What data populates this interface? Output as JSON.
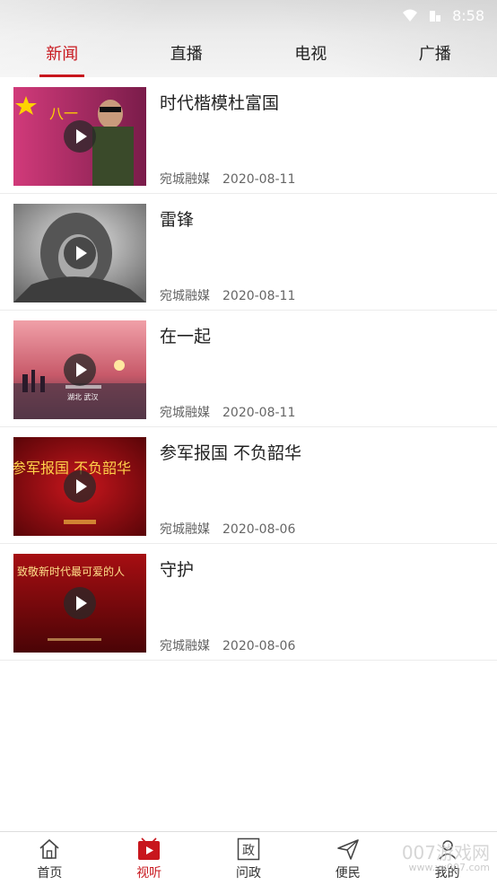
{
  "status_bar": {
    "time": "8:58",
    "icons": [
      "wifi-icon",
      "signal-icon",
      "battery-icon"
    ]
  },
  "tabs": [
    {
      "label": "新闻",
      "active": true
    },
    {
      "label": "直播",
      "active": false
    },
    {
      "label": "电视",
      "active": false
    },
    {
      "label": "广播",
      "active": false
    }
  ],
  "list": [
    {
      "title": "时代楷模杜富国",
      "source": "宛城融媒",
      "date": "2020-08-11",
      "thumb_text": "八一"
    },
    {
      "title": "雷锋",
      "source": "宛城融媒",
      "date": "2020-08-11",
      "thumb_text": ""
    },
    {
      "title": "在一起",
      "source": "宛城融媒",
      "date": "2020-08-11",
      "thumb_text": "湖北 武汉"
    },
    {
      "title": "参军报国 不负韶华",
      "source": "宛城融媒",
      "date": "2020-08-06",
      "thumb_text": "参军报国 不负韶华"
    },
    {
      "title": "守护",
      "source": "宛城融媒",
      "date": "2020-08-06",
      "thumb_text": "致敬新时代最可爱的人"
    }
  ],
  "bottom_nav": [
    {
      "label": "首页",
      "icon": "home-icon",
      "active": false
    },
    {
      "label": "视听",
      "icon": "video-icon",
      "active": true
    },
    {
      "label": "问政",
      "icon": "politics-icon",
      "active": false
    },
    {
      "label": "便民",
      "icon": "send-icon",
      "active": false
    },
    {
      "label": "我的",
      "icon": "profile-icon",
      "active": false
    }
  ],
  "watermark": {
    "line1": "007游戏网",
    "line2": "www.yx007.com"
  },
  "colors": {
    "accent": "#c8161d",
    "text": "#222222",
    "meta": "#666666"
  }
}
